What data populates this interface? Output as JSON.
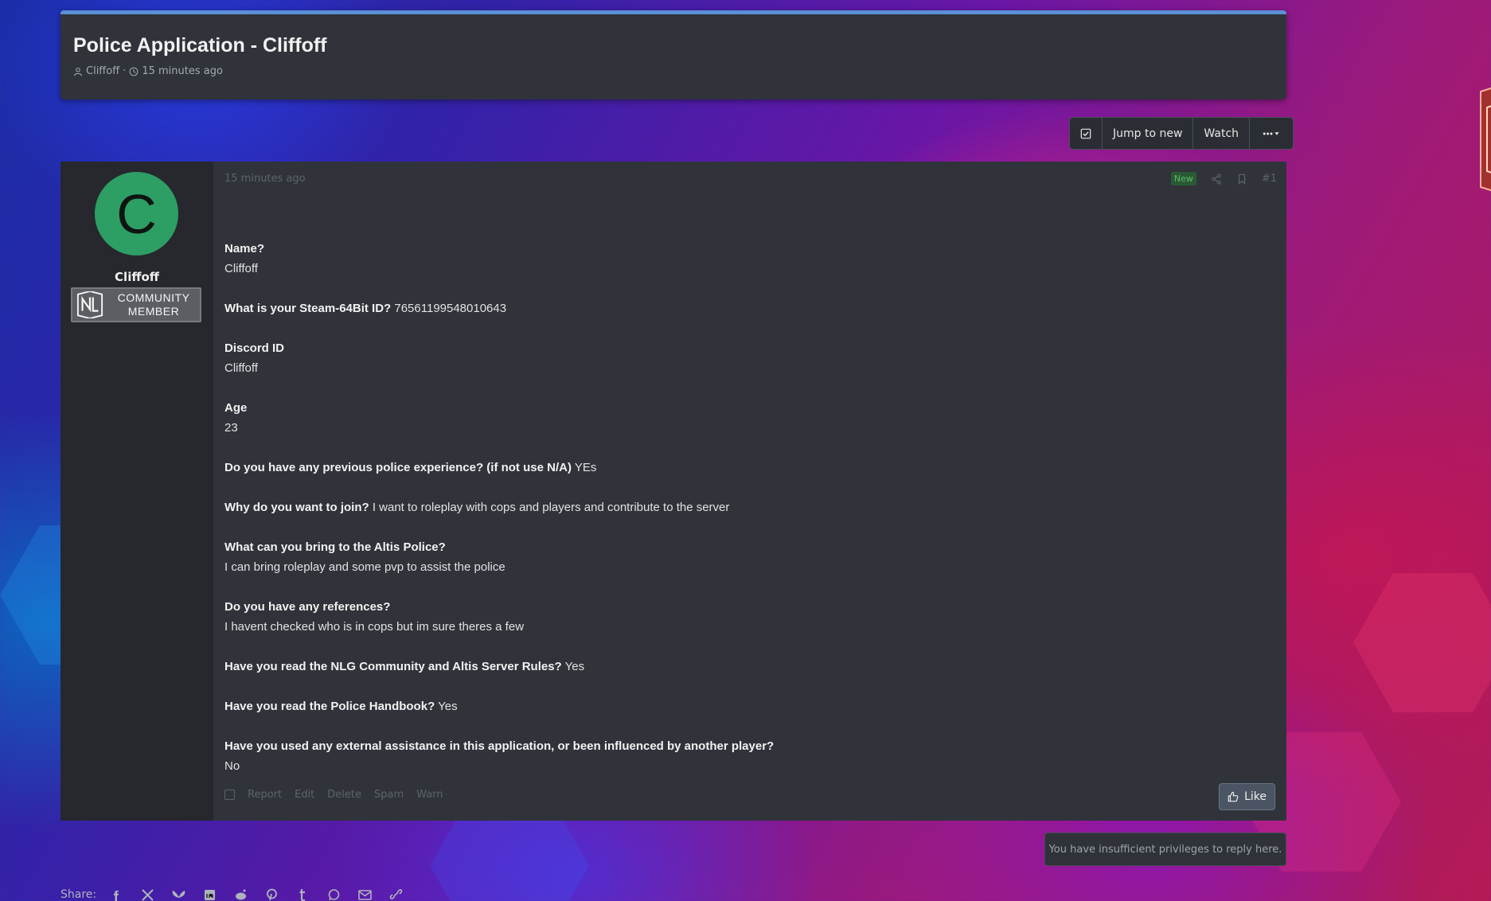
{
  "thread": {
    "title": "Police Application - Cliffoff",
    "author": "Cliffoff",
    "separator": "·",
    "posted": "15 minutes ago"
  },
  "toolbar": {
    "checkbox_icon": "checkbox-icon",
    "jump_to_new": "Jump to new",
    "watch": "Watch",
    "more_icon": "ellipsis-icon"
  },
  "post": {
    "avatar_letter": "C",
    "username": "Cliffoff",
    "banner_line1": "COMMUNITY",
    "banner_line2": "MEMBER",
    "banner_logo": "NL",
    "date": "15 minutes ago",
    "badge_new": "New",
    "post_number": "#1",
    "qa": [
      {
        "q": "Name?",
        "a": "Cliffoff",
        "newline": true
      },
      {
        "q": "What is your Steam-64Bit ID?",
        "a": "76561199548010643",
        "newline": false
      },
      {
        "q": "Discord ID",
        "a": "Cliffoff",
        "newline": true
      },
      {
        "q": "Age",
        "a": "23",
        "newline": true
      },
      {
        "q": "Do you have any previous police experience? (if not use N/A)",
        "a": "YEs",
        "newline": false
      },
      {
        "q": "Why do you want to join?",
        "a": "I want to roleplay with cops and players and contribute to the server",
        "newline": false
      },
      {
        "q": "What can you bring to the Altis Police?",
        "a": "I can bring roleplay and some pvp to assist the police",
        "newline": true
      },
      {
        "q": "Do you have any references?",
        "a": "I havent checked who is in cops but im sure theres a few",
        "newline": true
      },
      {
        "q": "Have you read the NLG Community and Altis Server Rules?",
        "a": "Yes",
        "newline": false
      },
      {
        "q": "Have you read the Police Handbook?",
        "a": "Yes",
        "newline": false
      },
      {
        "q": "Have you used any external assistance in this application, or been influenced by another player?",
        "a": "No",
        "newline": true
      }
    ],
    "footer_actions": [
      "Report",
      "Edit",
      "Delete",
      "Spam",
      "Warn"
    ],
    "like_label": "Like"
  },
  "no_privileges": "You have insufficient privileges to reply here.",
  "share": {
    "label": "Share:",
    "icons": [
      "facebook-icon",
      "x-icon",
      "bluesky-icon",
      "linkedin-icon",
      "reddit-icon",
      "pinterest-icon",
      "tumblr-icon",
      "whatsapp-icon",
      "email-icon",
      "link-icon"
    ]
  },
  "colors": {
    "accent": "#5b8fd6",
    "avatar_bg": "#2d9e64",
    "panel": "#30333a",
    "new_badge": "#5fb86c"
  }
}
